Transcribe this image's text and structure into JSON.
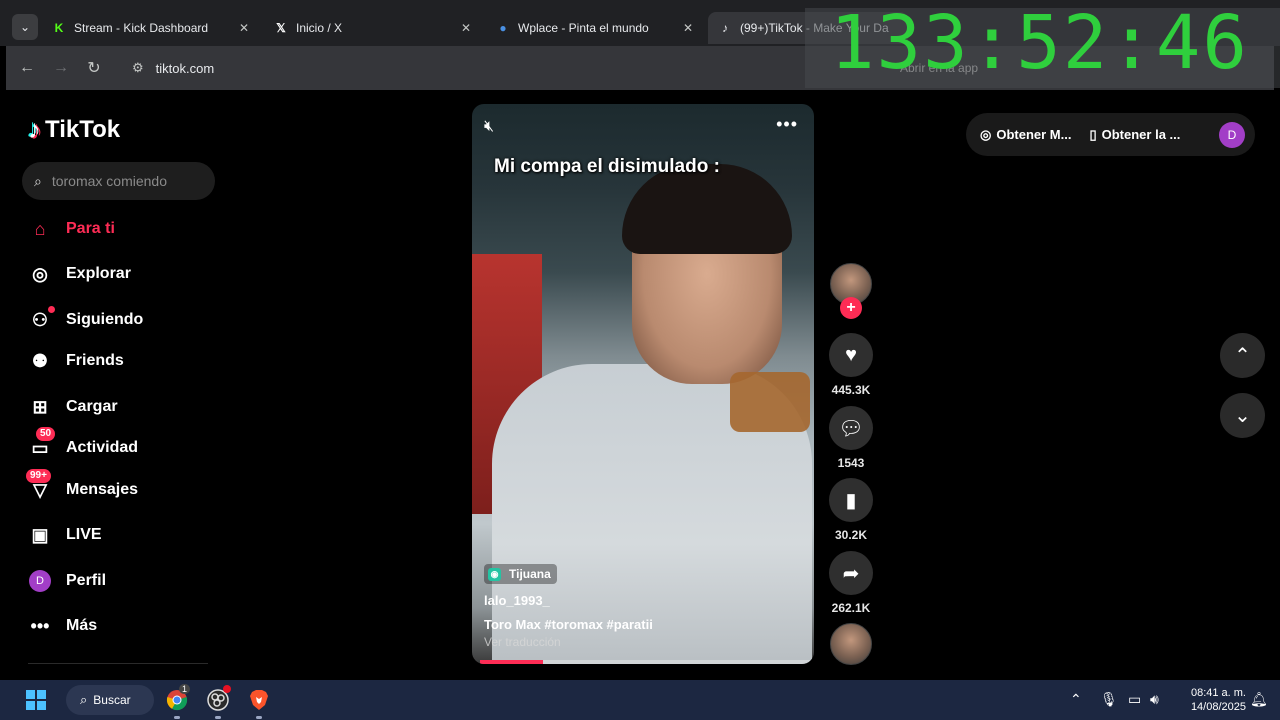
{
  "browser": {
    "tabs": [
      {
        "title": "Stream - Kick Dashboard",
        "icon": "kick-icon",
        "color": "#53fc18"
      },
      {
        "title": "Inicio / X",
        "icon": "x-icon",
        "color": "#ffffff"
      },
      {
        "title": "Wplace - Pinta el mundo",
        "icon": "globe-icon",
        "color": "#4a90e2"
      },
      {
        "title": "(99+)TikTok - Make Your Da",
        "icon": "tiktok-icon",
        "color": "#ffffff",
        "active": true
      }
    ],
    "url": "tiktok.com",
    "ghost_open_app": "Abrir en la app"
  },
  "overlay": {
    "timer": "133:52:46",
    "timer_color": "#2fcf3d"
  },
  "sidebar": {
    "logo": "TikTok",
    "search_placeholder": "toromax comiendo",
    "items": [
      {
        "label": "Para ti",
        "icon": "home-icon",
        "active": true
      },
      {
        "label": "Explorar",
        "icon": "compass-icon"
      },
      {
        "label": "Siguiendo",
        "icon": "following-icon"
      },
      {
        "label": "Friends",
        "icon": "friends-icon"
      },
      {
        "label": "Cargar",
        "icon": "upload-icon"
      },
      {
        "label": "Actividad",
        "icon": "activity-icon",
        "badge": "50"
      },
      {
        "label": "Mensajes",
        "icon": "messages-icon",
        "badge": "99+"
      },
      {
        "label": "LIVE",
        "icon": "live-icon"
      },
      {
        "label": "Perfil",
        "icon": "profile-avatar",
        "avatar_letter": "D"
      },
      {
        "label": "Más",
        "icon": "more-icon"
      }
    ]
  },
  "video": {
    "caption_overlay": "Mi compa el disimulado :",
    "location": "Tijuana",
    "author": "lalo_1993_",
    "description": "Toro Max #toromax  #paratii",
    "translate": "Ver traducción",
    "progress": 0.19
  },
  "actions": {
    "likes": "445.3K",
    "comments": "1543",
    "saves": "30.2K",
    "shares": "262.1K"
  },
  "top_actions": {
    "coins": "Obtener M...",
    "app": "Obtener la ...",
    "avatar_letter": "D"
  },
  "taskbar": {
    "search": "Buscar",
    "time": "08:41 a. m.",
    "date": "14/08/2025",
    "chrome_badge": "1"
  },
  "colors": {
    "accent": "#fe2c55",
    "avatar": "#a23ec7"
  }
}
